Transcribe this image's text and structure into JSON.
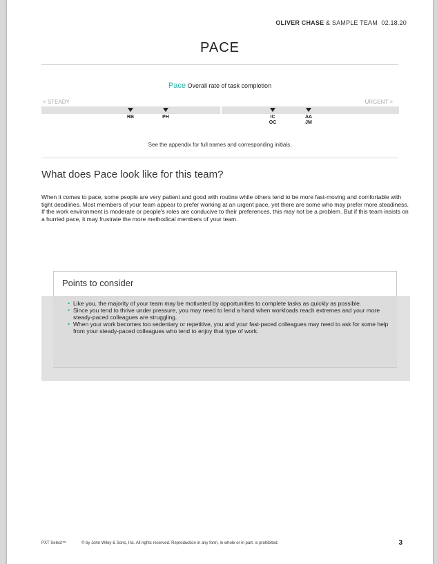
{
  "header": {
    "name": "OLIVER CHASE",
    "team_suffix": " & SAMPLE TEAM",
    "date": "02.18.20"
  },
  "title": "PACE",
  "pace": {
    "word": "Pace",
    "description": "Overall rate of task completion",
    "left_label": "< STEADY",
    "right_label": "URGENT >",
    "markers": [
      {
        "label": "RB"
      },
      {
        "label": "PH"
      },
      {
        "label": "IC\nOC"
      },
      {
        "label": "AA\nJM"
      }
    ],
    "appendix_note": "See the appendix for full names and corresponding initials."
  },
  "section": {
    "heading": "What does Pace look like for this team?",
    "body": "When it comes to pace, some people are very patient and good with routine while others tend to be more fast-moving and comfortable with tight deadlines. Most members of your team appear to prefer working at an urgent pace, yet there are some who may prefer more steadiness. If the work environment is moderate or people's roles are conducive to their preferences, this may not be a problem. But if this team insists on a hurried pace, it may frustrate the more methodical members of your team."
  },
  "points": {
    "title": "Points to consider",
    "items": [
      "Like you, the majority of your team may be motivated by opportunities to complete tasks as quickly as possible.",
      "Since you tend to thrive under pressure, you may need to lend a hand when workloads reach extremes and your more steady-paced colleagues are struggling.",
      "When your work becomes too sedentary or repetitive, you and your fast-paced colleagues may need to ask for some help from your steady-paced colleagues who tend to enjoy that type of work."
    ]
  },
  "footer": {
    "brand": "PXT Select™",
    "copyright": "© by John Wiley & Sons, Inc. All rights reserved. Reproduction in any form, in whole or in part, is prohibited.",
    "page_number": "3"
  },
  "colors": {
    "accent": "#22b3a6",
    "bar": "#e1e1e1"
  }
}
